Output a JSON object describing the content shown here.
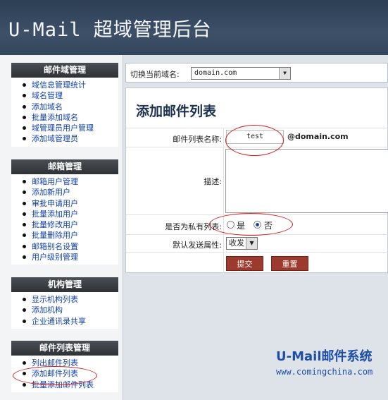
{
  "app": {
    "title": "U-Mail 超域管理后台"
  },
  "sidebar": {
    "sections": [
      {
        "title": "邮件域管理",
        "items": [
          "域信息管理统计",
          "域名管理",
          "添加域名",
          "批量添加域名",
          "域管理员用户管理",
          "添加域管理员"
        ]
      },
      {
        "title": "邮箱管理",
        "items": [
          "邮箱用户管理",
          "添加新用户",
          "审批申请用户",
          "批量添加用户",
          "批量修改用户",
          "批量删除用户",
          "邮箱别名设置",
          "用户级别管理"
        ]
      },
      {
        "title": "机构管理",
        "items": [
          "显示机构列表",
          "添加机构",
          "企业通讯录共享"
        ]
      },
      {
        "title": "邮件列表管理",
        "items": [
          "列出邮件列表",
          "添加邮件列表",
          "批量添加邮件列表"
        ]
      }
    ]
  },
  "topbar": {
    "label": "切换当前域名:",
    "selected_domain": "domain.com"
  },
  "form": {
    "title": "添加邮件列表",
    "list_name_label": "邮件列表名称:",
    "list_name_value": "test",
    "domain_suffix": "@domain.com",
    "description_label": "描述:",
    "private_label": "是否为私有列表:",
    "private_yes": "是",
    "private_no": "否",
    "private_selected": "否",
    "send_label": "默认发送属性:",
    "send_value": "收发",
    "submit": "提交",
    "reset": "重置"
  },
  "brand": {
    "name": "U-Mail邮件系统",
    "url": "www.comingchina.com"
  },
  "colors": {
    "header": "#3d5068",
    "link": "#0f3fa8",
    "button": "#9c3a2e",
    "annotation": "#d61e1e",
    "brand": "#1d4fa8"
  }
}
